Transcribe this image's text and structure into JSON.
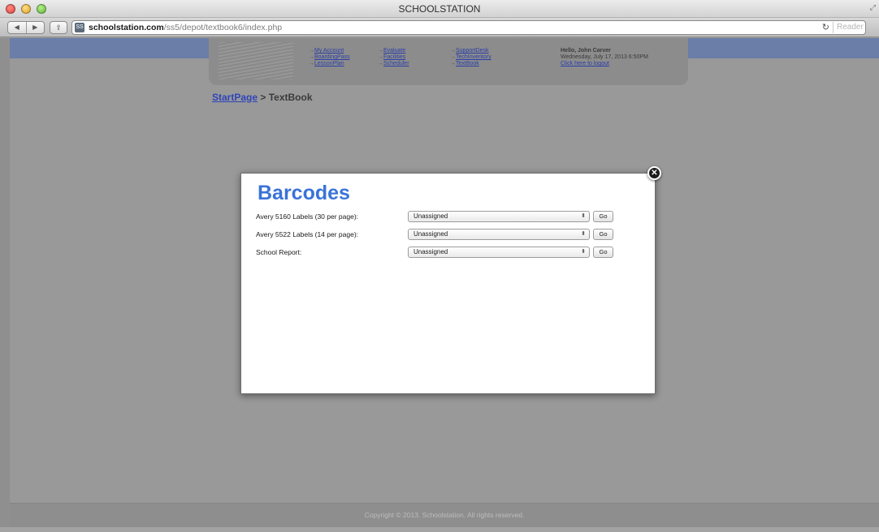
{
  "window": {
    "title": "SCHOOLSTATION"
  },
  "toolbar": {
    "url_host": "schoolstation.com",
    "url_path": "/ss5/depot/textbook6/index.php",
    "reader_label": "Reader",
    "favicon_text": "SS"
  },
  "header": {
    "nav_columns": [
      [
        "My Account",
        "BoardingPass",
        "LessonPlan"
      ],
      [
        "Evaluate",
        "Facilities",
        "Scheduler"
      ],
      [
        "SupportDesk",
        "TechInventory",
        "TextBook"
      ]
    ],
    "greeting": "Hello, John Carver",
    "datetime": "Wednesday, July 17, 2013 6:50PM",
    "logout_link": "Click here to logout"
  },
  "breadcrumb": {
    "root": "StartPage",
    "separator": " > ",
    "current": "TextBook"
  },
  "modal": {
    "title": "Barcodes",
    "rows": [
      {
        "label": "Avery 5160 Labels (30 per page):",
        "selected": "Unassigned",
        "button": "Go"
      },
      {
        "label": "Avery 5522 Labels (14 per page):",
        "selected": "Unassigned",
        "button": "Go"
      },
      {
        "label": "School Report:",
        "selected": "Unassigned",
        "button": "Go"
      }
    ]
  },
  "footer": {
    "copyright": "Copyright © 2013. Schoolstation. All rights reserved."
  },
  "colors": {
    "accent_title": "#3a73d8",
    "blue_band": "#6a7ea8",
    "link": "#2f44b8"
  }
}
